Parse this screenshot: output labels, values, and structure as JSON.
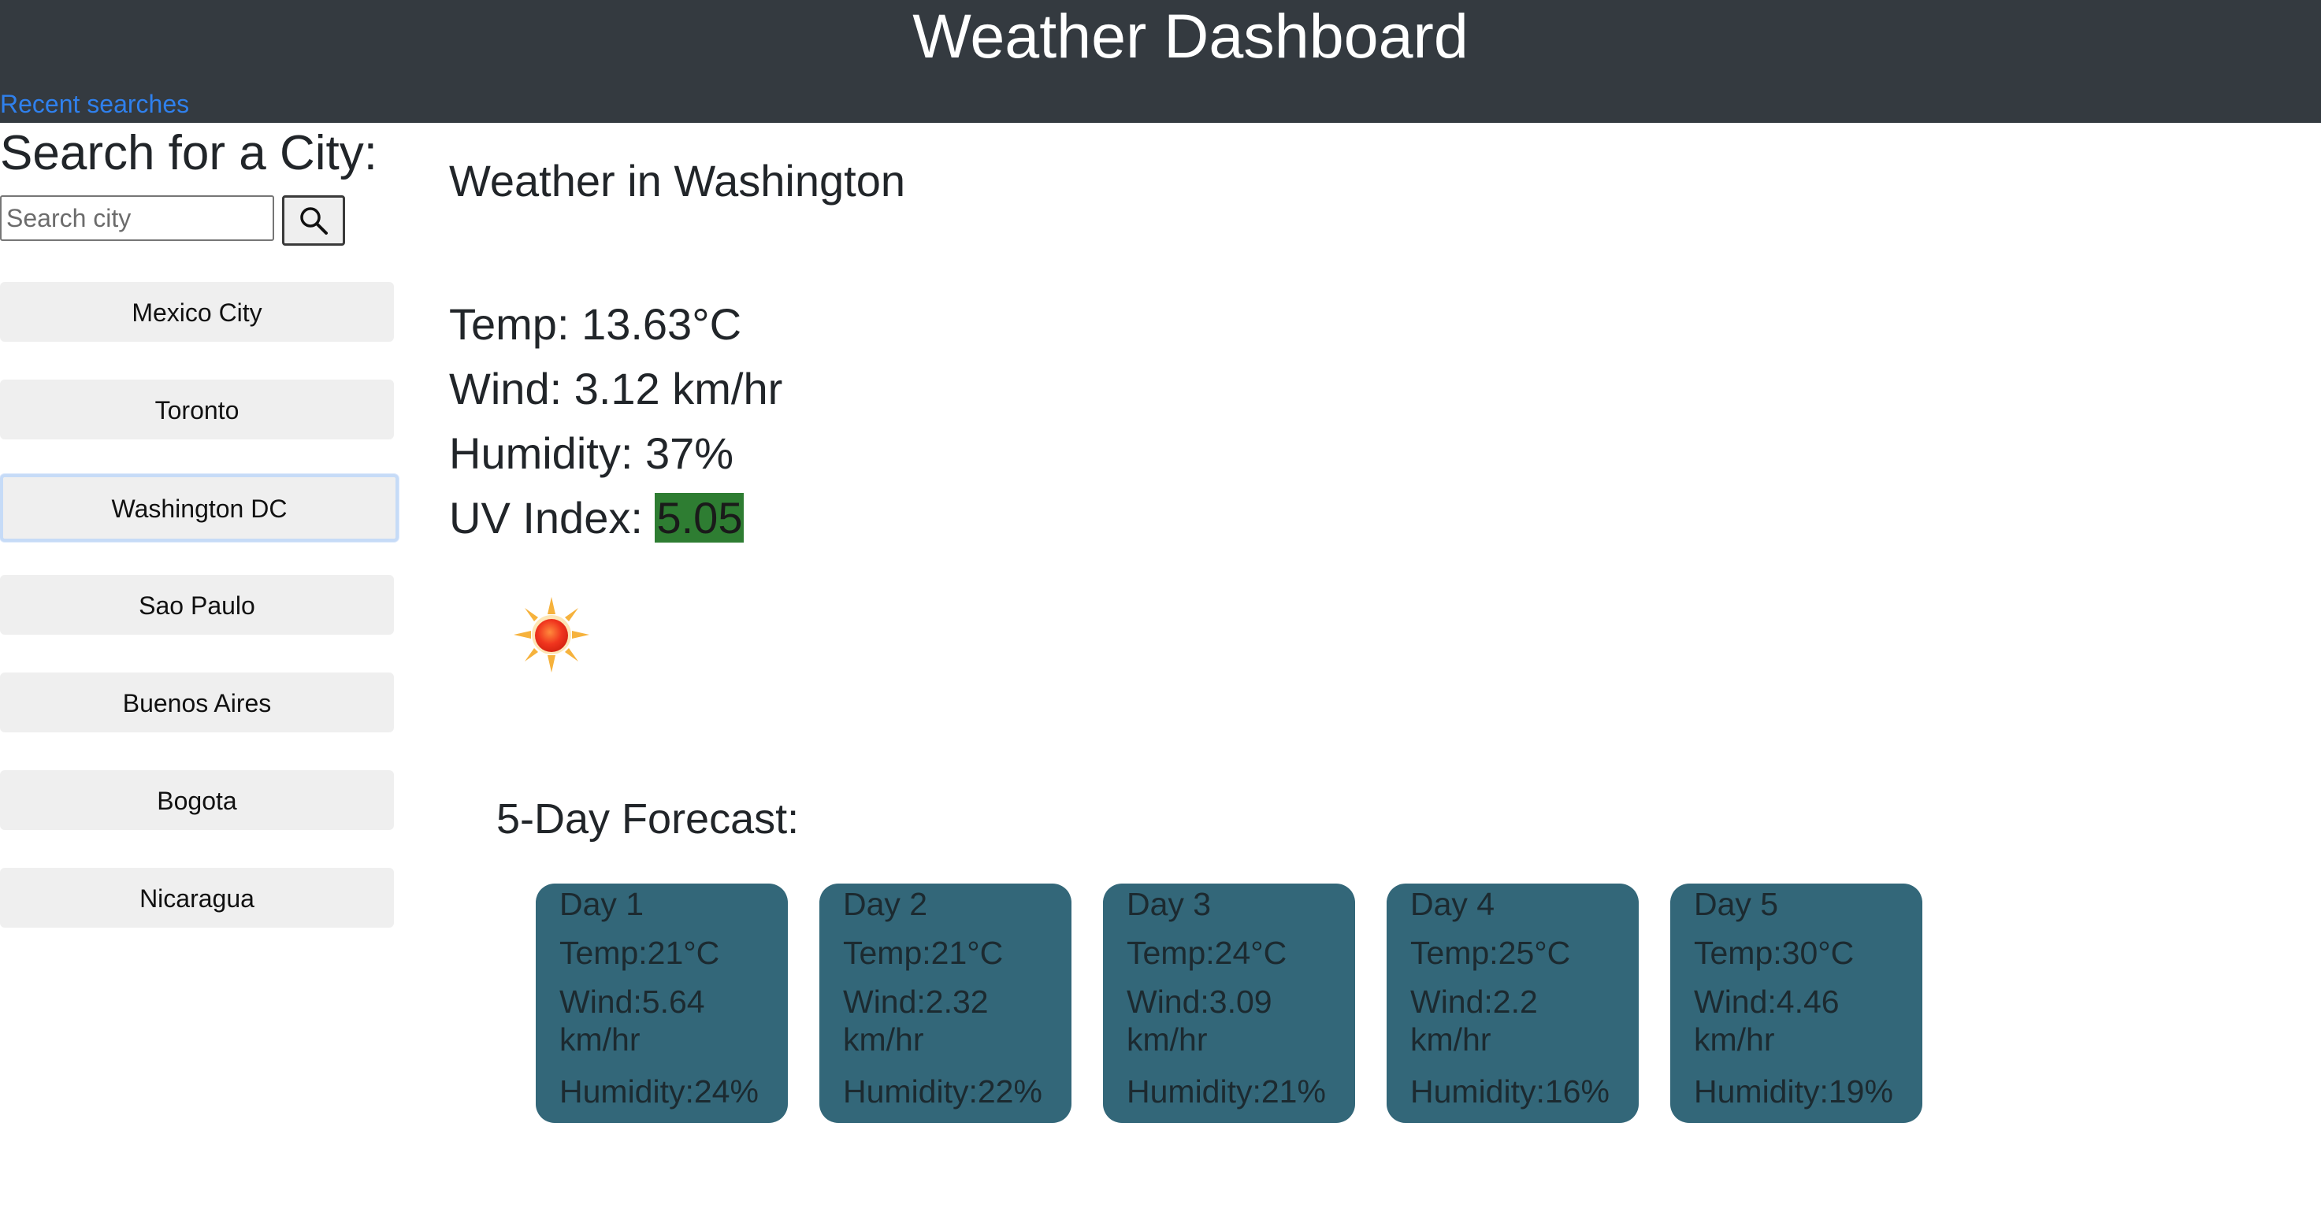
{
  "header": {
    "title": "Weather Dashboard",
    "recent_link": "Recent searches"
  },
  "sidebar": {
    "heading": "Search for a City:",
    "search_placeholder": "Search city",
    "search_value": "",
    "search_button_icon": "search-icon",
    "cities": [
      {
        "label": "Mexico City",
        "active": false
      },
      {
        "label": "Toronto",
        "active": false
      },
      {
        "label": "Washington DC",
        "active": true
      },
      {
        "label": "Sao Paulo",
        "active": false
      },
      {
        "label": "Buenos Aires",
        "active": false
      },
      {
        "label": "Bogota",
        "active": false
      },
      {
        "label": "Nicaragua",
        "active": false
      }
    ]
  },
  "current": {
    "title": "Weather in Washington",
    "temp_label": "Temp: ",
    "temp_value": "13.63°C",
    "wind_label": "Wind: ",
    "wind_value": "3.12 km/hr",
    "humidity_label": "Humidity: ",
    "humidity_value": "37%",
    "uv_label": "UV Index: ",
    "uv_value": "5.05",
    "uv_color": "#2e7d32",
    "icon": "sun-icon"
  },
  "forecast": {
    "heading": "5-Day Forecast:",
    "card_color": "#336779",
    "days": [
      {
        "day": "Day 1",
        "temp": "Temp:21°C",
        "wind": "Wind:5.64 km/hr",
        "humidity": "Humidity:24%"
      },
      {
        "day": "Day 2",
        "temp": "Temp:21°C",
        "wind": "Wind:2.32 km/hr",
        "humidity": "Humidity:22%"
      },
      {
        "day": "Day 3",
        "temp": "Temp:24°C",
        "wind": "Wind:3.09 km/hr",
        "humidity": "Humidity:21%"
      },
      {
        "day": "Day 4",
        "temp": "Temp:25°C",
        "wind": "Wind:2.2 km/hr",
        "humidity": "Humidity:16%"
      },
      {
        "day": "Day 5",
        "temp": "Temp:30°C",
        "wind": "Wind:4.46 km/hr",
        "humidity": "Humidity:19%"
      }
    ]
  }
}
